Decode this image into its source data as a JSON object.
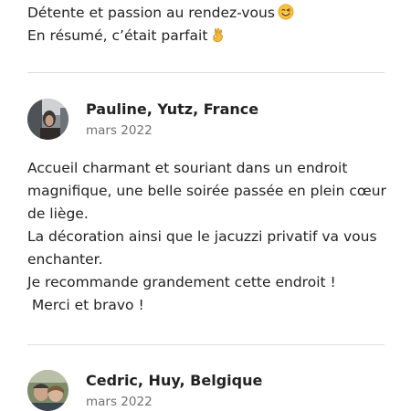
{
  "previous_review": {
    "lines": [
      "Détente et passion au rendez-vous",
      "En résumé, c’était parfait"
    ],
    "icons": [
      "winking-face-emoji",
      "ok-hand-emoji"
    ]
  },
  "reviews": [
    {
      "name": "Pauline, Yutz, France",
      "date": "mars 2022",
      "lines": [
        "Accueil charmant et souriant dans un endroit",
        "magnifique, une belle soirée passée en plein cœur",
        "de liège.",
        "La décoration ainsi que le jacuzzi privatif va vous",
        "enchanter.",
        "Je recommande grandement cette endroit !",
        " Merci et bravo !"
      ]
    },
    {
      "name": "Cedric, Huy, Belgique",
      "date": "mars 2022"
    }
  ]
}
